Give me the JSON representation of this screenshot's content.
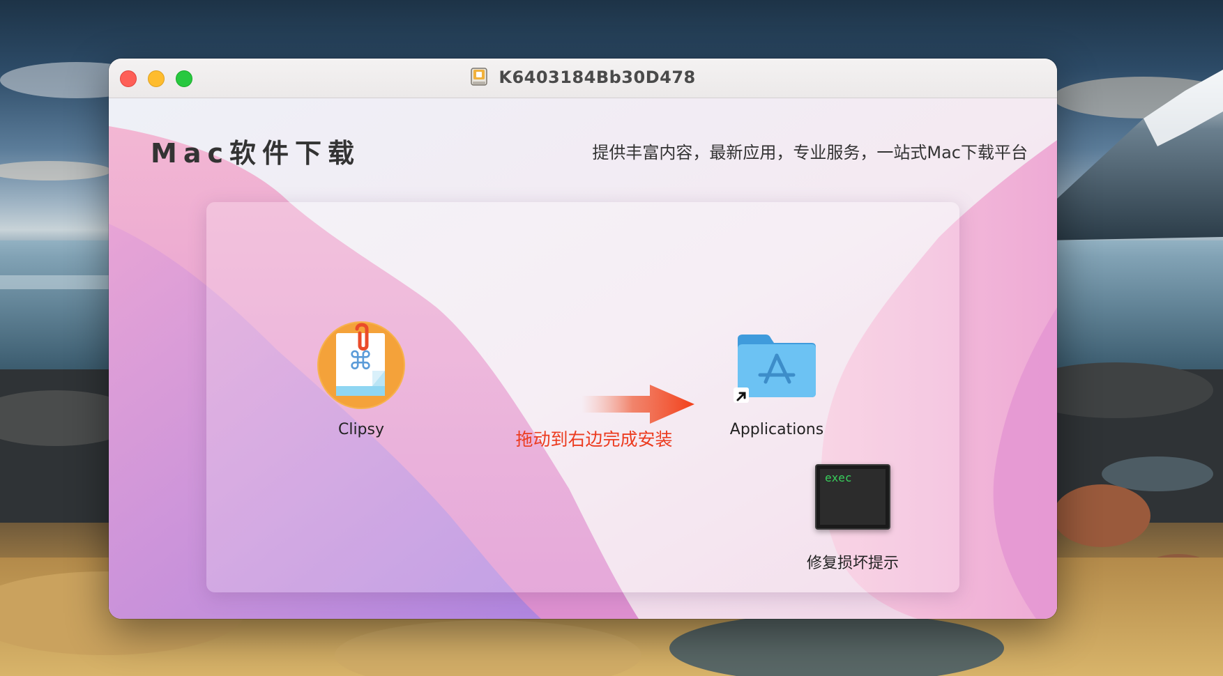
{
  "window": {
    "title": "K6403184Bb30D478"
  },
  "header": {
    "brand": "Mac软件下载",
    "tagline": "提供丰富内容，最新应用，专业服务，一站式Mac下载平台"
  },
  "installer": {
    "app_label": "Clipsy",
    "instruction": "拖动到右边完成安装",
    "applications_label": "Applications",
    "repair_label": "修复损坏提示",
    "exec_text": "exec"
  },
  "icons": {
    "app": "clipsy-app-icon",
    "applications": "applications-folder-icon",
    "alias": "alias-arrow-icon",
    "repair": "terminal-exec-icon",
    "disk": "disk-image-icon",
    "arrow": "right-arrow-icon"
  },
  "colors": {
    "close": "#fe5f57",
    "minimize": "#febc2e",
    "maximize": "#28c840",
    "instruction": "#ec3b1f",
    "exec_text": "#38d05c",
    "folder": "#5ab7ee"
  }
}
